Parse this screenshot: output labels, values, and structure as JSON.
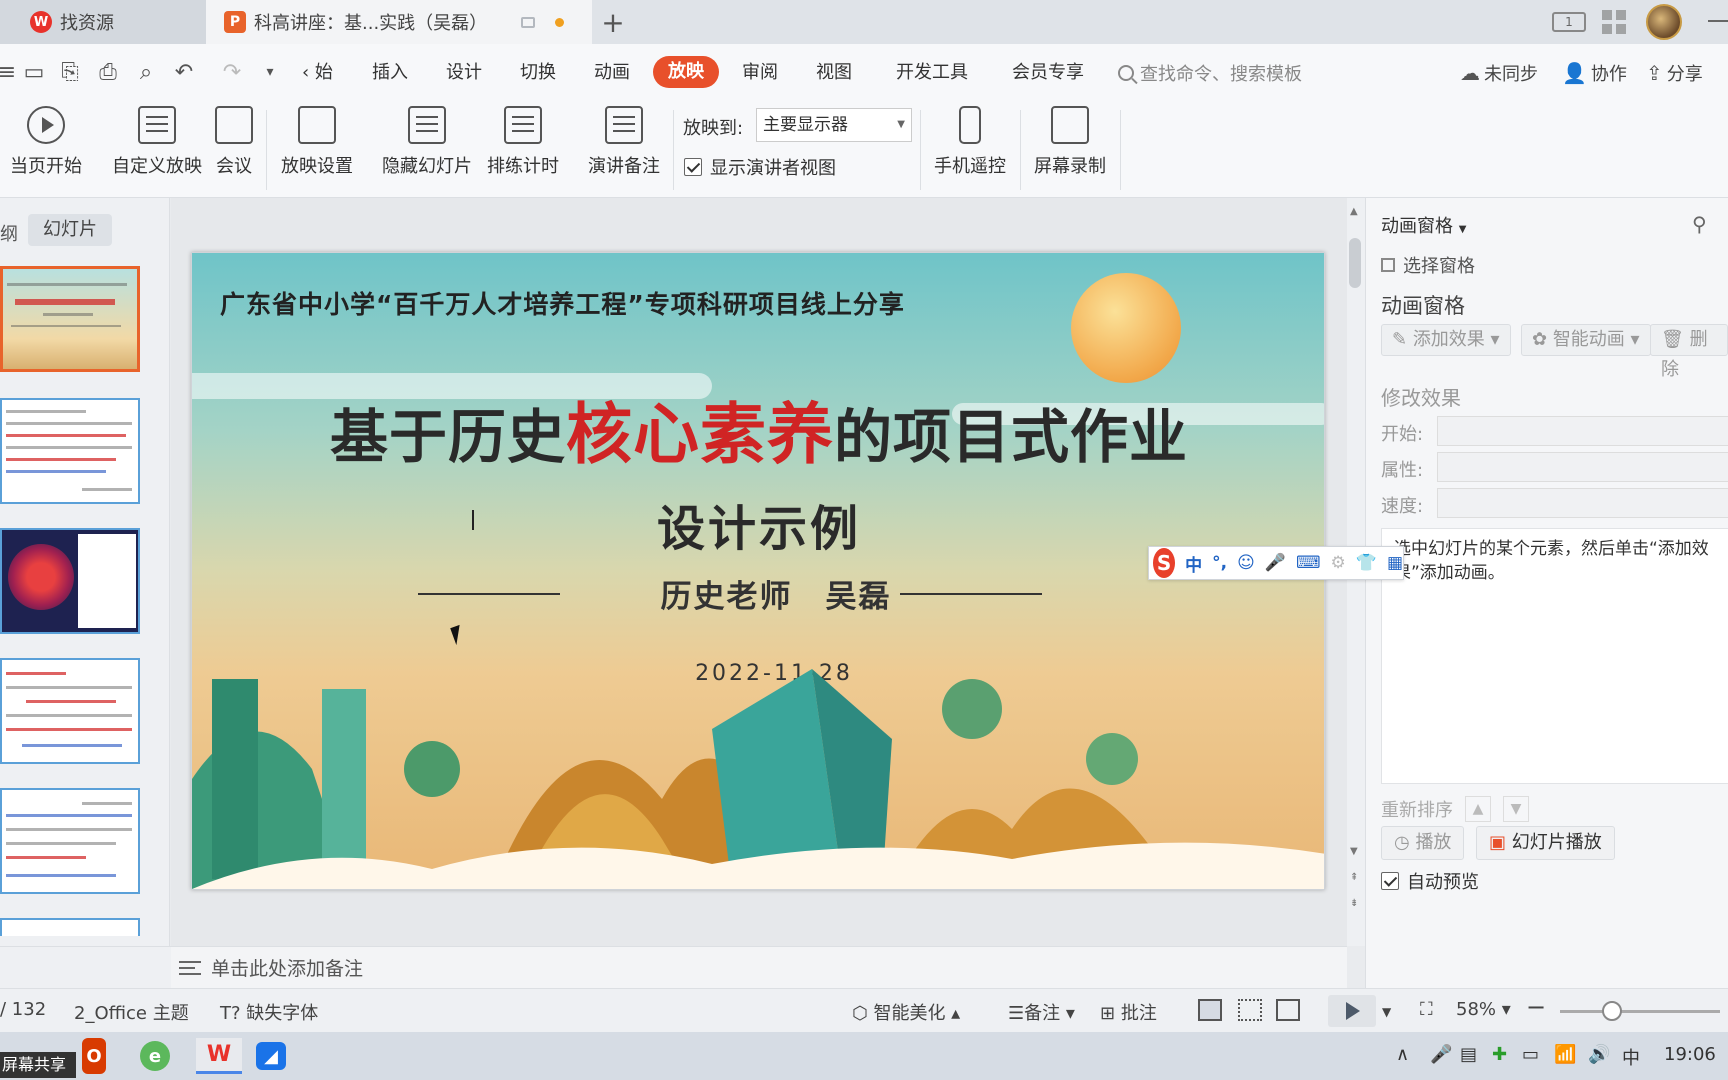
{
  "titlebar": {
    "tab_resource": "找资源",
    "tab_document": "科高讲座：基...实践（吴磊）",
    "new_tab": "+",
    "layout_badge": "1"
  },
  "menu": {
    "overflow": "‹ 始",
    "items": [
      "插入",
      "设计",
      "切换",
      "动画"
    ],
    "active": "放映",
    "items_after": [
      "审阅",
      "视图",
      "开发工具",
      "会员专享"
    ],
    "search_placeholder": "查找命令、搜索模板",
    "sync": "未同步",
    "collab": "协作",
    "share": "分享"
  },
  "ribbon": {
    "from_current": "当页开始",
    "custom_show": "自定义放映",
    "meeting": "会议",
    "show_settings": "放映设置",
    "hide_slide": "隐藏幻灯片",
    "rehearse": "排练计时",
    "speaker_notes": "演讲备注",
    "play_to_label": "放映到:",
    "play_to_value": "主要显示器",
    "presenter_view": "显示演讲者视图",
    "phone_remote": "手机遥控",
    "screen_record": "屏幕录制"
  },
  "left_panel": {
    "outline_tab": "纲",
    "slides_tab": "幻灯片",
    "add": "+"
  },
  "slide": {
    "header": "广东省中小学“百千万人才培养工程”专项科研项目线上分享",
    "title_before": "基于历史",
    "title_highlight": "核心素养",
    "title_after": "的项目式作业",
    "subtitle": "设计示例",
    "author": "历史老师　吴磊",
    "date": "2022-11-28"
  },
  "notes_placeholder": "单击此处添加备注",
  "right_panel": {
    "pane_dropdown": "动画窗格",
    "select_pane": "选择窗格",
    "pane_title": "动画窗格",
    "add_effect": "添加效果",
    "smart_anim": "智能动画",
    "delete": "删除",
    "modify_effect": "修改效果",
    "start_label": "开始:",
    "property_label": "属性:",
    "speed_label": "速度:",
    "hint": "选中幻灯片的某个元素，然后单击“添加效果”添加动画。",
    "reorder": "重新排序",
    "play": "播放",
    "slideshow": "幻灯片播放",
    "auto_preview": "自动预览"
  },
  "ime": {
    "logo": "S",
    "mode": "中",
    "punct": "°,"
  },
  "status": {
    "page": "/ 132",
    "theme": "2_Office 主题",
    "missing_font": "缺失字体",
    "beautify": "智能美化",
    "notes": "备注",
    "comments": "批注",
    "zoom": "58%"
  },
  "taskbar": {
    "share_badge": "屏幕共享",
    "ime_mode": "中",
    "time": "19:06"
  },
  "colors": {
    "accent": "#e8502b",
    "title_highlight": "#d02424",
    "thumb_active": "#e8632b"
  }
}
